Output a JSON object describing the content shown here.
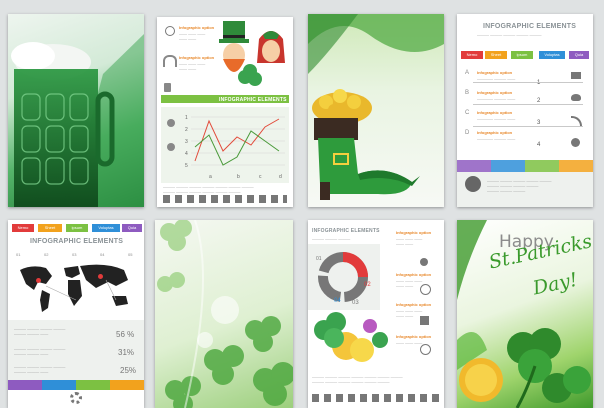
{
  "card2": {
    "opt1": "Infographic option",
    "opt2": "Infographic option",
    "title": "INFOGRAPHIC ELEMENTS",
    "axis_y": [
      "1",
      "2",
      "3",
      "4",
      "5"
    ],
    "axis_x": [
      "a",
      "b",
      "c",
      "d"
    ]
  },
  "card4": {
    "title": "INFOGRAPHIC ELEMENTS",
    "tabs": [
      "Nemo",
      "Sheet",
      "ipsum",
      "Voluptas",
      "Quia"
    ],
    "letters": [
      "A",
      "B",
      "C",
      "D"
    ],
    "option": "Infographic option",
    "numbers": [
      "1",
      "2",
      "3",
      "4"
    ],
    "tab_colors": [
      "#e23b3b",
      "#f2a21d",
      "#7cc142",
      "#2f8fd8",
      "#8e5bc0"
    ]
  },
  "card5": {
    "tabs": [
      "Nemo",
      "Sheet",
      "ipsum",
      "Voluptas",
      "Quia"
    ],
    "title": "INFOGRAPHIC ELEMENTS",
    "percents": [
      "56 %",
      "31%",
      "25%"
    ],
    "ticks": [
      "01",
      "02",
      "03",
      "04",
      "05"
    ]
  },
  "card7": {
    "title": "INFOGRAPHIC ELEMENTS",
    "option": "Infographic option",
    "chart_labels": [
      "01",
      "02",
      "03",
      "04"
    ]
  },
  "card8": {
    "happy": "Happy",
    "line1": "St.Patricks",
    "line2": "Day!"
  }
}
